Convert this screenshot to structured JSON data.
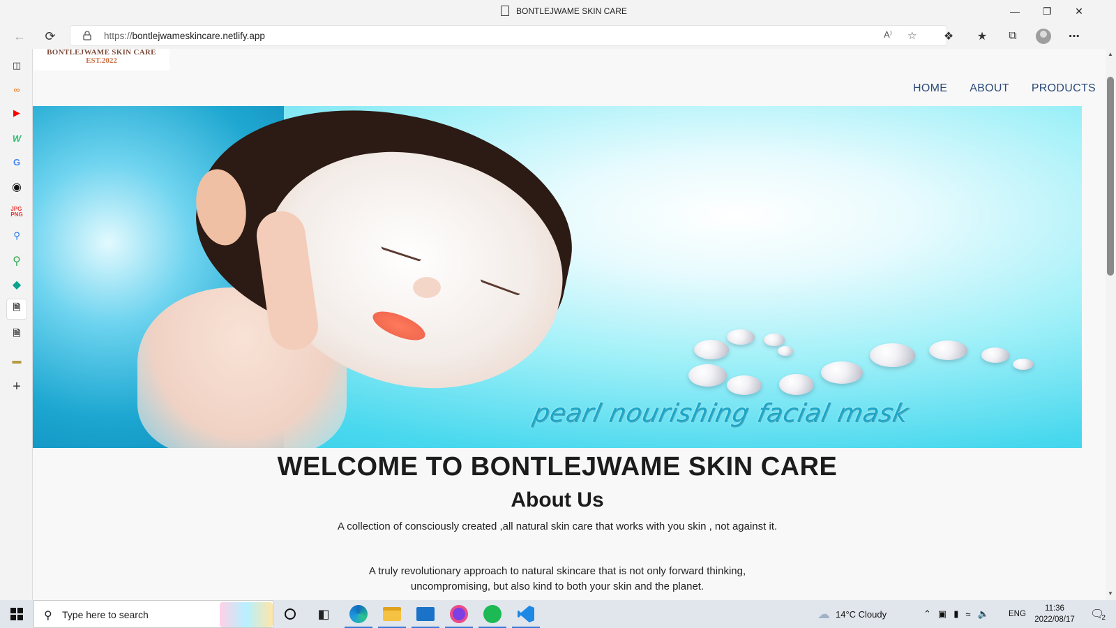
{
  "window": {
    "title": "BONTLEJWAME SKIN CARE",
    "controls": {
      "minimize": "—",
      "restore": "❐",
      "close": "✕"
    }
  },
  "browser": {
    "url_scheme": "https://",
    "url_host": "bontlejwameskincare.netlify.app",
    "icons": [
      "back-icon",
      "refresh-icon",
      "lock-icon",
      "read-aloud-icon",
      "add-favorite-icon",
      "extensions-icon",
      "favorites-icon",
      "collections-icon",
      "profile-icon",
      "more-icon"
    ],
    "read_aloud_label": "A⁾"
  },
  "sidebar": {
    "icons": [
      "tab-actions-icon",
      "pinned-app-icon",
      "youtube-icon",
      "app-w-icon",
      "google-icon",
      "github-icon",
      "jpg-png-icon",
      "search-icon",
      "maps-icon",
      "diamond-app-icon",
      "document-icon",
      "document-icon",
      "card-icon",
      "add-icon"
    ]
  },
  "site": {
    "logo_line1": "BONTLEJWAME SKIN CARE",
    "logo_line2": "EST.2022",
    "nav": [
      "HOME",
      "ABOUT",
      "PRODUCTS"
    ],
    "hero_caption": "pearl nourishing facial mask",
    "welcome": "WELCOME TO BONTLEJWAME SKIN CARE",
    "about_heading": "About Us",
    "about_p1": "A collection of consciously created ,all natural skin care that works with you skin , not against it.",
    "about_p2": "A truly revolutionary approach to natural skincare that is not only forward thinking, uncompromising, but also kind to both your skin and the planet."
  },
  "taskbar": {
    "search_placeholder": "Type here to search",
    "weather": "14°C  Cloudy",
    "language": "ENG",
    "time": "11:36",
    "date": "2022/08/17",
    "notification_count": "2"
  },
  "colors": {
    "nav_link": "#2b4a78",
    "hero_cyan": "#2ec8e6",
    "taskbar_bg": "#e1e6ec"
  }
}
